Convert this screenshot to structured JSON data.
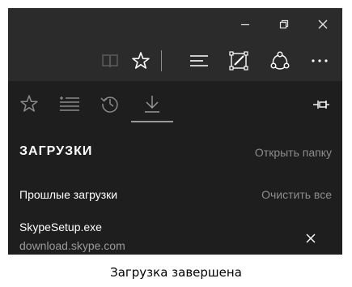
{
  "window_controls": {
    "minimize_icon": "minimize-icon",
    "restore_icon": "restore-icon",
    "close_icon": "close-icon"
  },
  "toolbar": {
    "icons": [
      "reading-view-icon",
      "favorites-star-icon",
      "hub-icon",
      "web-note-icon",
      "share-icon",
      "more-icon"
    ]
  },
  "hub": {
    "tabs": [
      "favorites-icon",
      "reading-list-icon",
      "history-icon",
      "downloads-icon"
    ],
    "active_tab": "downloads",
    "title": "ЗАГРУЗКИ",
    "open_folder": "Открыть папку",
    "past_downloads": "Прошлые загрузки",
    "clear_all": "Очистить все",
    "downloads": [
      {
        "name": "SkypeSetup.exe",
        "source": "download.skype.com"
      }
    ]
  },
  "caption": "Загрузка завершена",
  "colors": {
    "titlebar": "#2b2b2b",
    "hub_background": "#1e1e1e",
    "text_primary": "#ffffff",
    "text_secondary": "#8c8c8c"
  }
}
